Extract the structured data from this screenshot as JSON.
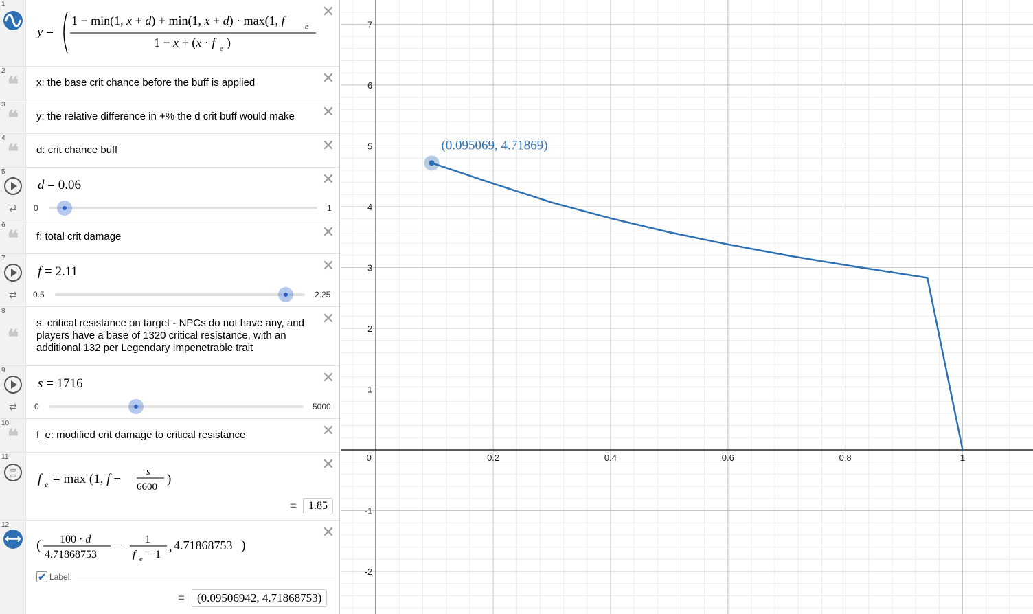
{
  "expressions": [
    {
      "index": "1",
      "icon": "desmos-logo-icon"
    },
    {
      "index": "2",
      "type": "note",
      "text": "x: the base crit chance before the buff is applied"
    },
    {
      "index": "3",
      "type": "note",
      "text": "y: the relative difference in +% the d crit buff would make"
    },
    {
      "index": "4",
      "type": "note",
      "text": "d: crit chance buff"
    },
    {
      "index": "5",
      "type": "slider",
      "variable": "d",
      "value": "0.06",
      "min": "0",
      "max": "1",
      "position": 0.06
    },
    {
      "index": "6",
      "type": "note",
      "text": "f: total crit damage"
    },
    {
      "index": "7",
      "type": "slider",
      "variable": "f",
      "value": "2.11",
      "min": "0.5",
      "max": "2.25",
      "position": 0.92
    },
    {
      "index": "8",
      "type": "note",
      "text": "s: critical resistance on target - NPCs do not have any, and players have a base of 1320 critical resistance, with an additional 132 per Legendary Impenetrable trait"
    },
    {
      "index": "9",
      "type": "slider",
      "variable": "s",
      "value": "1716",
      "min": "0",
      "max": "5000",
      "position": 0.3432
    },
    {
      "index": "10",
      "type": "note",
      "text": "f_e: modified crit damage to critical resistance"
    },
    {
      "index": "11",
      "type": "expression",
      "result": "1.85"
    },
    {
      "index": "12",
      "type": "point",
      "point_value": "4.71868753",
      "label_text": "Label:",
      "result": "(0.09506942, 4.71868753)"
    }
  ],
  "graph": {
    "point_label": "(0.095069, 4.71869)",
    "curve_color": "#2d70b3",
    "x_ticks": [
      "0",
      "0.2",
      "0.4",
      "0.6",
      "0.8",
      "1"
    ],
    "y_ticks": [
      "7",
      "6",
      "5",
      "4",
      "3",
      "2",
      "1",
      "-1",
      "-2"
    ]
  },
  "chart_data": {
    "type": "line",
    "x_range": [
      -0.06,
      1.12
    ],
    "y_range": [
      -2.7,
      7.4
    ],
    "series": [
      {
        "x": [
          0.095,
          0.2,
          0.3,
          0.4,
          0.5,
          0.6,
          0.7,
          0.8,
          0.94,
          1.0
        ],
        "y": [
          4.72,
          4.38,
          4.07,
          3.81,
          3.58,
          3.38,
          3.2,
          3.04,
          2.83,
          0.0
        ]
      }
    ],
    "highlight_point": {
      "x": 0.095069,
      "y": 4.71869
    }
  }
}
